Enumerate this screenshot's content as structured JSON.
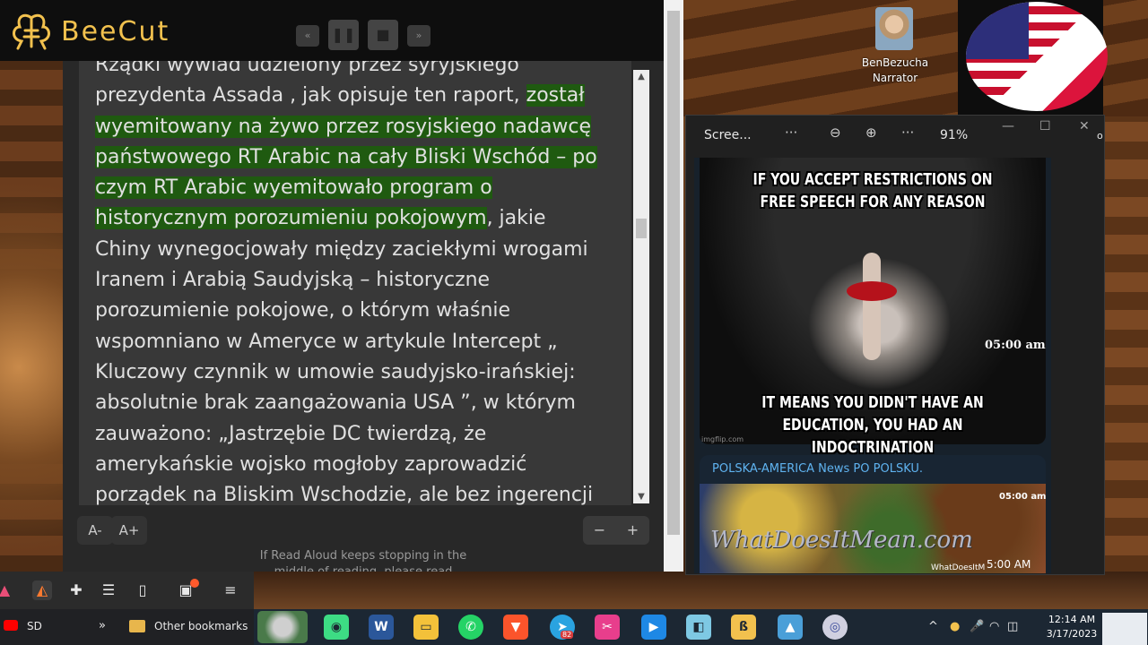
{
  "beecut": {
    "app_name": "BeeCut",
    "rewind": "«",
    "pause": "❚❚",
    "stop": "■",
    "forward": "»"
  },
  "reader": {
    "lines": [
      {
        "text": "Rządki wywiad udzielony przez syryjskiego",
        "hl": ""
      },
      {
        "text": "prezydenta Assada , jak opisuje ten raport, ",
        "hl": "został"
      },
      {
        "text": "",
        "hl": "wyemitowany na żywo przez rosyjskiego nadawcę"
      },
      {
        "text": "",
        "hl": "państwowego RT Arabic na cały Bliski Wschód – po"
      },
      {
        "text": "",
        "hl": "czym RT Arabic wyemitowało program o"
      },
      {
        "text": "",
        "hl": "historycznym porozumieniu pokojowym",
        "after": ", jakie"
      },
      {
        "text": "Chiny wynegocjowały między zaciekłymi wrogami",
        "hl": ""
      },
      {
        "text": "Iranem i Arabią Saudyjską – historyczne",
        "hl": ""
      },
      {
        "text": "porozumienie pokojowe, o którym właśnie",
        "hl": ""
      },
      {
        "text": "wspomniano w Ameryce w artykule Intercept „",
        "hl": ""
      },
      {
        "text": "Kluczowy czynnik w umowie saudyjsko-irańskiej:",
        "hl": ""
      },
      {
        "text": "absolutnie brak zaangażowania USA ”, w którym",
        "hl": ""
      },
      {
        "text": "zauważono: „Jastrzębie DC twierdzą, że",
        "hl": ""
      },
      {
        "text": "amerykańskie wojsko mogłoby zaprowadzić",
        "hl": ""
      },
      {
        "text": "porządek na Bliskim Wschodzie, ale bez ingerencji",
        "hl": ""
      }
    ],
    "font_smaller": "A-",
    "font_larger": "A+",
    "zoom_minus": "−",
    "zoom_plus": "+",
    "footer_note": "If Read Aloud keeps stopping in the middle of reading, please read",
    "scroll_position": 0.35
  },
  "narrator": {
    "name": "BenBezucha",
    "role": "Narrator"
  },
  "viewer": {
    "title": "Scree...",
    "more1": "···",
    "zoom_out": "⊖",
    "zoom_in": "⊕",
    "more2": "···",
    "zoom_level": "91%",
    "minimize": "—",
    "maximize": "☐",
    "close": "✕",
    "edge_text": "o",
    "meme_top": "IF YOU ACCEPT RESTRICTIONS ON FREE SPEECH FOR ANY REASON",
    "meme_bottom": "IT MEANS YOU DIDN'T HAVE AN EDUCATION, YOU HAD AN INDOCTRINATION",
    "meme_time": "05:00 am",
    "meme_credit": "imgflip.com",
    "channel_name": "POLSKA-AMERICA News PO POLSKU.",
    "image_watermark": "WhatDoesItMean.com",
    "image_time": "05:00 am",
    "image_source": "WhatDoesItM",
    "message_time": "5:00 AM"
  },
  "bookmarks": {
    "sd_label": "SD",
    "more": "»",
    "other": "Other bookmarks"
  },
  "taskbar": {
    "apps": [
      "ant",
      "android",
      "Word",
      "Explorer",
      "WhatsApp",
      "Brave",
      "Telegram",
      "Tool",
      "Media",
      "Files",
      "BeeCut",
      "Photos",
      "Disc"
    ],
    "telegram_badge": "82",
    "tray_up": "^",
    "time": "12:14 AM",
    "date": "3/17/2023"
  },
  "colors": {
    "highlight": "#1f5a10",
    "beecut_gold": "#f2c14e",
    "channel_blue": "#5fb3f0"
  }
}
